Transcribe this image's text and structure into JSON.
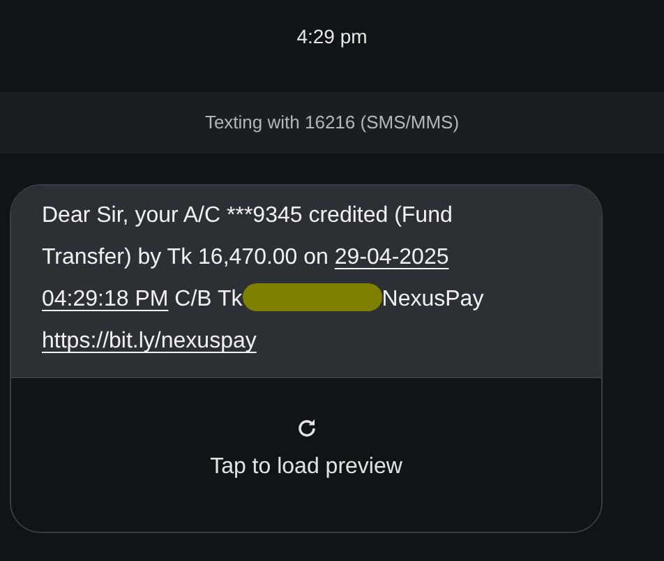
{
  "timestamp": "4:29 pm",
  "banner": "Texting with 16216 (SMS/MMS)",
  "message": {
    "parts": [
      {
        "kind": "text",
        "text": "Dear Sir, your A/C ***9345 credited (Fund Transfer) by Tk 16,470.00 on "
      },
      {
        "kind": "link",
        "text": "29-04-2025"
      },
      {
        "kind": "break"
      },
      {
        "kind": "link",
        "text": "04:29:18 PM"
      },
      {
        "kind": "text",
        "text": " C/B Tk"
      },
      {
        "kind": "redaction"
      },
      {
        "kind": "text",
        "text": "NexusPay "
      },
      {
        "kind": "link",
        "text": "https://bit.ly/nexuspay"
      }
    ]
  },
  "preview": {
    "label": "Tap to load preview"
  }
}
